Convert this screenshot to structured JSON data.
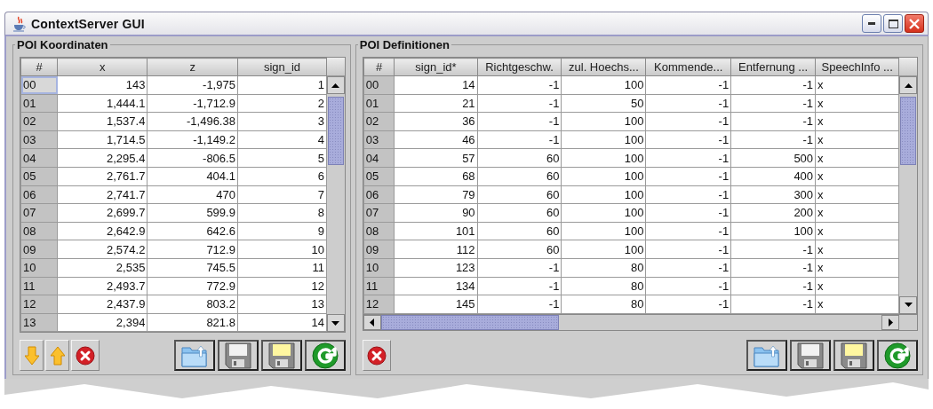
{
  "window": {
    "title": "ContextServer GUI",
    "controls": [
      {
        "kind": "minimize"
      },
      {
        "kind": "maximize"
      },
      {
        "kind": "close"
      }
    ]
  },
  "panels": [
    {
      "title": "POI Koordinaten",
      "columns": [
        {
          "label": "#",
          "kind": "index"
        },
        {
          "label": "x",
          "kind": "number"
        },
        {
          "label": "z",
          "kind": "number"
        },
        {
          "label": "sign_id",
          "kind": "number"
        }
      ],
      "horizontal_scrollbar": false,
      "rows": [
        {
          "focused": true,
          "cells": [
            "00",
            "143",
            "-1,975",
            "1"
          ]
        },
        {
          "focused": false,
          "cells": [
            "01",
            "1,444.1",
            "-1,712.9",
            "2"
          ]
        },
        {
          "focused": false,
          "cells": [
            "02",
            "1,537.4",
            "-1,496.38",
            "3"
          ]
        },
        {
          "focused": false,
          "cells": [
            "03",
            "1,714.5",
            "-1,149.2",
            "4"
          ]
        },
        {
          "focused": false,
          "cells": [
            "04",
            "2,295.4",
            "-806.5",
            "5"
          ]
        },
        {
          "focused": false,
          "cells": [
            "05",
            "2,761.7",
            "404.1",
            "6"
          ]
        },
        {
          "focused": false,
          "cells": [
            "06",
            "2,741.7",
            "470",
            "7"
          ]
        },
        {
          "focused": false,
          "cells": [
            "07",
            "2,699.7",
            "599.9",
            "8"
          ]
        },
        {
          "focused": false,
          "cells": [
            "08",
            "2,642.9",
            "642.6",
            "9"
          ]
        },
        {
          "focused": false,
          "cells": [
            "09",
            "2,574.2",
            "712.9",
            "10"
          ]
        },
        {
          "focused": false,
          "cells": [
            "10",
            "2,535",
            "745.5",
            "11"
          ]
        },
        {
          "focused": false,
          "cells": [
            "11",
            "2,493.7",
            "772.9",
            "12"
          ]
        },
        {
          "focused": false,
          "cells": [
            "12",
            "2,437.9",
            "803.2",
            "13"
          ]
        },
        {
          "focused": false,
          "cells": [
            "13",
            "2,394",
            "821.8",
            "14"
          ]
        }
      ],
      "tools": [
        {
          "kind": "move-down"
        },
        {
          "kind": "move-up"
        },
        {
          "kind": "delete"
        }
      ],
      "actions": [
        {
          "kind": "open"
        },
        {
          "kind": "save"
        },
        {
          "kind": "save-as"
        },
        {
          "kind": "reload"
        }
      ]
    },
    {
      "title": "POI Definitionen",
      "columns": [
        {
          "label": "#",
          "kind": "index"
        },
        {
          "label": "sign_id*",
          "kind": "number"
        },
        {
          "label": "Richtgeschw.",
          "kind": "number"
        },
        {
          "label": "zul. Hoechs...",
          "kind": "number"
        },
        {
          "label": "Kommende...",
          "kind": "number"
        },
        {
          "label": "Entfernung ...",
          "kind": "number"
        },
        {
          "label": "SpeechInfo ...",
          "kind": "text"
        }
      ],
      "horizontal_scrollbar": true,
      "rows": [
        {
          "focused": false,
          "cells": [
            "00",
            "14",
            "-1",
            "100",
            "-1",
            "-1",
            "x"
          ]
        },
        {
          "focused": false,
          "cells": [
            "01",
            "21",
            "-1",
            "50",
            "-1",
            "-1",
            "x"
          ]
        },
        {
          "focused": false,
          "cells": [
            "02",
            "36",
            "-1",
            "100",
            "-1",
            "-1",
            "x"
          ]
        },
        {
          "focused": false,
          "cells": [
            "03",
            "46",
            "-1",
            "100",
            "-1",
            "-1",
            "x"
          ]
        },
        {
          "focused": false,
          "cells": [
            "04",
            "57",
            "60",
            "100",
            "-1",
            "500",
            "x"
          ]
        },
        {
          "focused": false,
          "cells": [
            "05",
            "68",
            "60",
            "100",
            "-1",
            "400",
            "x"
          ]
        },
        {
          "focused": false,
          "cells": [
            "06",
            "79",
            "60",
            "100",
            "-1",
            "300",
            "x"
          ]
        },
        {
          "focused": false,
          "cells": [
            "07",
            "90",
            "60",
            "100",
            "-1",
            "200",
            "x"
          ]
        },
        {
          "focused": false,
          "cells": [
            "08",
            "101",
            "60",
            "100",
            "-1",
            "100",
            "x"
          ]
        },
        {
          "focused": false,
          "cells": [
            "09",
            "112",
            "60",
            "100",
            "-1",
            "-1",
            "x"
          ]
        },
        {
          "focused": false,
          "cells": [
            "10",
            "123",
            "-1",
            "80",
            "-1",
            "-1",
            "x"
          ]
        },
        {
          "focused": false,
          "cells": [
            "11",
            "134",
            "-1",
            "80",
            "-1",
            "-1",
            "x"
          ]
        },
        {
          "focused": false,
          "cells": [
            "12",
            "145",
            "-1",
            "80",
            "-1",
            "-1",
            "x"
          ]
        }
      ],
      "tools": [
        {
          "kind": "delete"
        }
      ],
      "actions": [
        {
          "kind": "open"
        },
        {
          "kind": "save"
        },
        {
          "kind": "save-as"
        },
        {
          "kind": "reload"
        }
      ]
    }
  ]
}
